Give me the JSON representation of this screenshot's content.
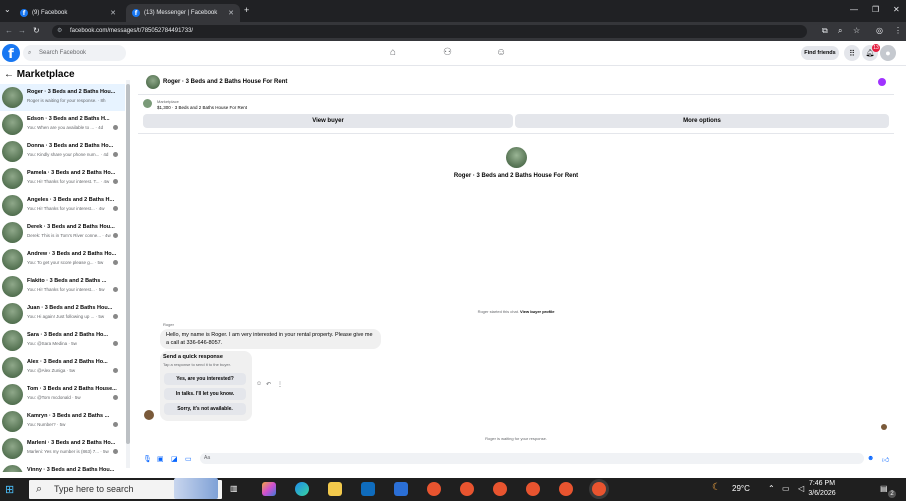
{
  "browser": {
    "tabs": [
      {
        "label": "(9) Facebook",
        "active": false
      },
      {
        "label": "(13) Messenger | Facebook",
        "active": true
      }
    ],
    "url": "facebook.com/messages/t/785052784491733/"
  },
  "header": {
    "search_placeholder": "Search Facebook",
    "find_friends": "Find friends",
    "notification_count": "13"
  },
  "sidebar": {
    "title": "Marketplace",
    "conversations": [
      {
        "name": "Roger · 3 Beds and 2 Baths Hou...",
        "preview": "Roger is waiting for your response. · 8h",
        "active": true
      },
      {
        "name": "Edson · 3 Beds and 2 Baths H...",
        "preview": "You: When are you available to ... · 4d",
        "active": false
      },
      {
        "name": "Donna · 3 Beds and 2 Baths Ho...",
        "preview": "You: Kindly share your phone num... · 4d",
        "active": false
      },
      {
        "name": "Pamela · 3 Beds and 2 Baths Ho...",
        "preview": "You: Hi! Thanks for your interest. T... · 4w",
        "active": false
      },
      {
        "name": "Angeles · 3 Beds and 2 Baths H...",
        "preview": "You: Hi! Thanks for your interest... · 4w",
        "active": false
      },
      {
        "name": "Derek · 3 Beds and 2 Baths Hou...",
        "preview": "Derek: This is in Tom's River conne... · 4w",
        "active": false
      },
      {
        "name": "Andrew · 3 Beds and 2 Baths Ho...",
        "preview": "You: To get your score please g... · 5w",
        "active": false
      },
      {
        "name": "Flakito · 3 Beds and 2 Baths ...",
        "preview": "You: Hi! Thanks for your interest... · 5w",
        "active": false
      },
      {
        "name": "Juan · 3 Beds and 2 Baths Hou...",
        "preview": "You: Hi again! Just following up ... · 5w",
        "active": false
      },
      {
        "name": "Sara · 3 Beds and 2 Baths Ho...",
        "preview": "You: @Sara Medina · 5w",
        "active": false
      },
      {
        "name": "Alex · 3 Beds and 2 Baths Ho...",
        "preview": "You: @Alex Zuniga · 5w",
        "active": false
      },
      {
        "name": "Tom · 3 Beds and 2 Baths House...",
        "preview": "You: @Tom mcdonald · 5w",
        "active": false
      },
      {
        "name": "Kamryn · 3 Beds and 2 Baths ...",
        "preview": "You: Number? · 5w",
        "active": false
      },
      {
        "name": "Marleni · 3 Beds and 2 Baths Ho...",
        "preview": "Marleni: Yes my number is (863) 7... · 5w",
        "active": false
      },
      {
        "name": "Vinny · 3 Beds and 2 Baths Hou...",
        "preview": "",
        "active": false
      }
    ]
  },
  "chat": {
    "title": "Roger · 3 Beds and 2 Baths House For Rent",
    "listing_category": "Marketplace",
    "listing_text": "$1,300 · 3 Beds and 2 Baths House For Rent",
    "view_buyer": "View buyer",
    "more_options": "More options",
    "center_title": "Roger · 3 Beds and 2 Baths House For Rent",
    "started_text": "Roger started this chat.",
    "started_link": "View buyer profile",
    "sender": "Roger",
    "message": "Hello, my name is Roger. I am very interested in your rental property. Please give me a call at 336-646-8057.",
    "quick_title": "Send a quick response",
    "quick_sub": "Tap a response to send it to the buyer.",
    "quick_responses": [
      "Yes, are you interested?",
      "In talks. I'll let you know.",
      "Sorry, it's not available."
    ],
    "waiting": "Roger is waiting for your response.",
    "composer_placeholder": "Aa"
  },
  "taskbar": {
    "search_placeholder": "Type here to search",
    "temperature": "29°C",
    "time": "7:46 PM",
    "date": "3/6/2026",
    "notif_count": "2"
  }
}
